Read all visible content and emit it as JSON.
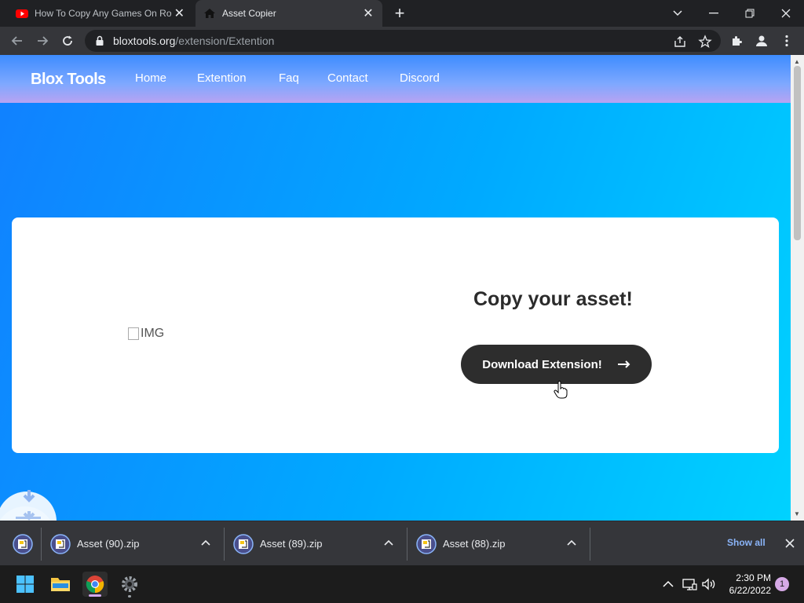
{
  "browser": {
    "tabs": [
      {
        "title": "How To Copy Any Games On Rob",
        "favicon": "youtube-icon"
      },
      {
        "title": "Asset Copier",
        "favicon": "house-icon"
      }
    ],
    "address": {
      "domain": "bloxtools.org",
      "path": "/extension/Extention"
    }
  },
  "site": {
    "brand": "Blox Tools",
    "nav": [
      "Home",
      "Extention",
      "Faq",
      "Contact",
      "Discord"
    ],
    "card": {
      "image_alt": "IMG",
      "title": "Copy your asset!",
      "button": "Download Extension!",
      "button_icon": "arrow-right-icon"
    }
  },
  "downloads": {
    "items": [
      "Asset (90).zip",
      "Asset (89).zip",
      "Asset (88).zip"
    ],
    "show_all": "Show all"
  },
  "taskbar": {
    "time": "2:30 PM",
    "date": "6/22/2022",
    "notifications": "1"
  },
  "colors": {
    "page_gradient_start": "#1180ff",
    "page_gradient_end": "#00d2ff",
    "button_bg": "#2d2d2d",
    "link_blue": "#8ab4f8"
  }
}
